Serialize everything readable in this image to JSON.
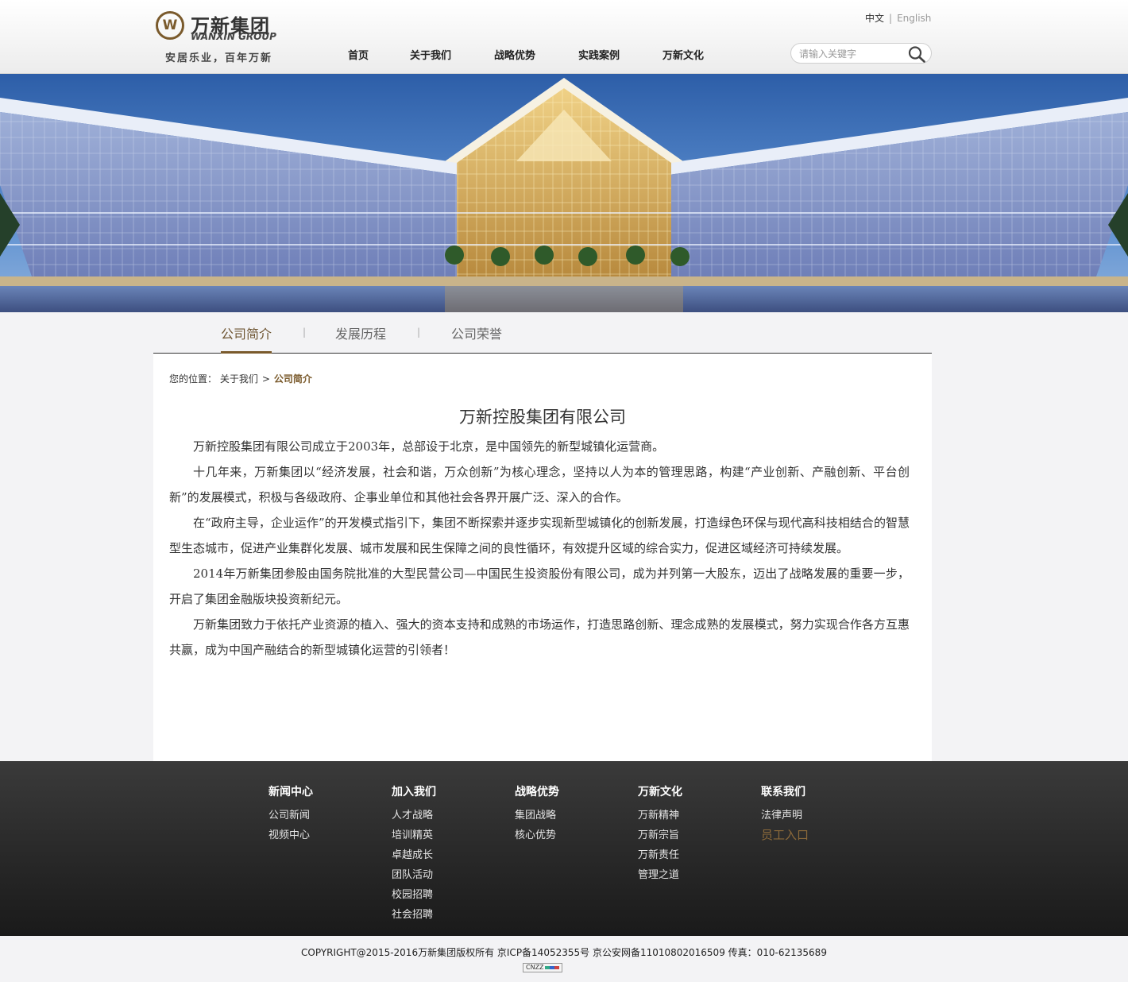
{
  "brand": {
    "name_cn": "万新集团",
    "name_en": "WANXIN GROUP",
    "slogan": "安居乐业，百年万新"
  },
  "lang": {
    "cn": "中文",
    "sep": "|",
    "en": "English"
  },
  "nav": {
    "items": [
      "首页",
      "关于我们",
      "战略优势",
      "实践案例",
      "万新文化"
    ]
  },
  "search": {
    "placeholder": "请输入关键字"
  },
  "subnav": {
    "tabs": [
      "公司简介",
      "发展历程",
      "公司荣誉"
    ],
    "active": "公司简介",
    "sep": "|"
  },
  "breadcrumb": {
    "label": "您的位置：",
    "parent": "关于我们",
    "gt": ">",
    "current": "公司简介"
  },
  "article": {
    "title": "万新控股集团有限公司",
    "paragraphs": [
      "万新控股集团有限公司成立于2003年，总部设于北京，是中国领先的新型城镇化运营商。",
      "十几年来，万新集团以“经济发展，社会和谐，万众创新”为核心理念，坚持以人为本的管理思路，构建“产业创新、产融创新、平台创新”的发展模式，积极与各级政府、企事业单位和其他社会各界开展广泛、深入的合作。",
      "在“政府主导，企业运作”的开发模式指引下，集团不断探索并逐步实现新型城镇化的创新发展，打造绿色环保与现代高科技相结合的智慧型生态城市，促进产业集群化发展、城市发展和民生保障之间的良性循环，有效提升区域的综合实力，促进区域经济可持续发展。",
      "2014年万新集团参股由国务院批准的大型民营公司—中国民生投资股份有限公司，成为并列第一大股东，迈出了战略发展的重要一步，开启了集团金融版块投资新纪元。",
      " 万新集团致力于依托产业资源的植入、强大的资本支持和成熟的市场运作，打造思路创新、理念成熟的发展模式，努力实现合作各方互惠共赢，成为中国产融结合的新型城镇化运营的引领者！"
    ]
  },
  "footer": {
    "columns": [
      {
        "title": "新闻中心",
        "links": [
          "公司新闻",
          "视频中心"
        ]
      },
      {
        "title": "加入我们",
        "links": [
          "人才战略",
          "培训精英",
          "卓越成长",
          "团队活动",
          "校园招聘",
          "社会招聘"
        ]
      },
      {
        "title": "战略优势",
        "links": [
          "集团战略",
          "核心优势"
        ]
      },
      {
        "title": "万新文化",
        "links": [
          "万新精神",
          "万新宗旨",
          "万新责任",
          "管理之道"
        ]
      },
      {
        "title": "联系我们",
        "links": [
          "法律声明",
          "员工入口"
        ]
      }
    ],
    "copyright": "COPYRIGHT@2015-2016万新集团版权所有 京ICP备14052355号 京公安网备11010802016509 传真：010-62135689",
    "badge": "CNZZ"
  },
  "colors": {
    "accent": "#7a5a2c",
    "footer_bg": "#242424",
    "page_bg": "#f3f3f5"
  }
}
